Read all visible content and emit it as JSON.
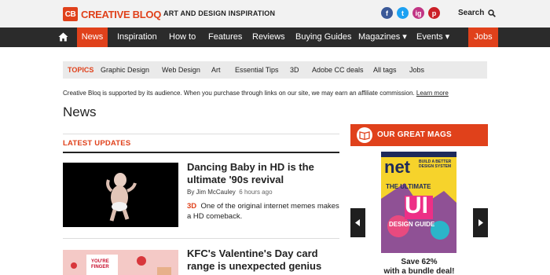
{
  "header": {
    "logo_mark": "CB",
    "logo_text": "CREATIVE BLOQ",
    "tagline": "ART AND DESIGN INSPIRATION",
    "social": [
      "f",
      "t",
      "ig",
      "p"
    ],
    "search_label": "Search"
  },
  "nav": {
    "items": [
      "News",
      "Inspiration",
      "How to",
      "Features",
      "Reviews",
      "Buying Guides",
      "Magazines ▾",
      "Events ▾",
      "Jobs"
    ]
  },
  "topics": {
    "label": "TOPICS",
    "items": [
      "Graphic Design",
      "Web Design",
      "Art",
      "Essential Tips",
      "3D",
      "Adobe CC deals",
      "All tags",
      "Jobs"
    ]
  },
  "disclaimer": {
    "text": "Creative Bloq is supported by its audience. When you purchase through links on our site, we may earn an affiliate commission.",
    "link": "Learn more"
  },
  "page": {
    "title": "News",
    "section_heading": "LATEST UPDATES"
  },
  "articles": [
    {
      "title": "Dancing Baby in HD is the ultimate '90s revival",
      "author_prefix": "By",
      "author": "Jim McCauley",
      "time": "6 hours ago",
      "tag": "3D",
      "strap": "One of the original internet memes makes a HD comeback."
    },
    {
      "title": "KFC's Valentine's Day card range is unexpected genius",
      "thumb_text": "YOU'RE FINGER"
    }
  ],
  "sidebar": {
    "heading": "OUR GREAT MAGS",
    "cover_brand": "net",
    "cover_headline_1": "THE ULTIMATE",
    "cover_headline_2": "UI",
    "cover_headline_3": "DESIGN GUIDE",
    "cover_side": "BUILD A BETTER DESIGN SYSTEM",
    "offer_1": "Save 62%",
    "offer_2": "with a bundle deal!"
  },
  "colors": {
    "accent": "#e0411b",
    "nav_bg": "#2b2b2b"
  }
}
